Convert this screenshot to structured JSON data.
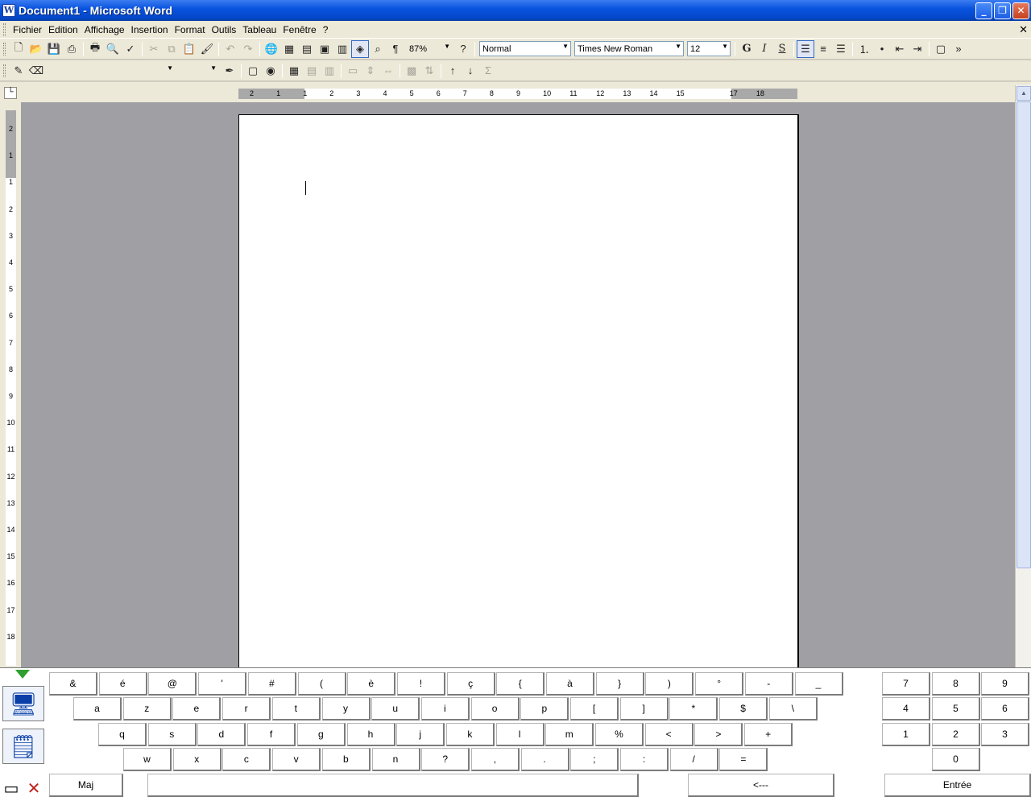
{
  "window": {
    "title": "Document1 - Microsoft Word",
    "app_icon": "W"
  },
  "menu": [
    "Fichier",
    "Edition",
    "Affichage",
    "Insertion",
    "Format",
    "Outils",
    "Tableau",
    "Fenêtre",
    "?"
  ],
  "toolbar": {
    "zoom": "87%",
    "style": "Normal",
    "font": "Times New Roman",
    "size": "12",
    "bold": "G",
    "italic": "I",
    "underline": "S"
  },
  "ruler_h": [
    "2",
    "1",
    "1",
    "2",
    "3",
    "4",
    "5",
    "6",
    "7",
    "8",
    "9",
    "10",
    "11",
    "12",
    "13",
    "14",
    "15",
    "17",
    "18"
  ],
  "ruler_v": [
    "2",
    "1",
    "1",
    "2",
    "3",
    "4",
    "5",
    "6",
    "7",
    "8",
    "9",
    "10",
    "11",
    "12",
    "13",
    "14",
    "15",
    "16",
    "17",
    "18"
  ],
  "keyboard": {
    "row1": [
      "&",
      "é",
      "@",
      "'",
      "#",
      "(",
      "è",
      "!",
      "ç",
      "{",
      "à",
      "}",
      ")",
      "°",
      "-",
      "_"
    ],
    "row2": [
      "a",
      "z",
      "e",
      "r",
      "t",
      "y",
      "u",
      "i",
      "o",
      "p",
      "[",
      "]",
      "*",
      "$",
      "\\"
    ],
    "row3": [
      "q",
      "s",
      "d",
      "f",
      "g",
      "h",
      "j",
      "k",
      "l",
      "m",
      "%",
      "<",
      ">",
      "+"
    ],
    "row4": [
      "w",
      "x",
      "c",
      "v",
      "b",
      "n",
      "?",
      ",",
      ".",
      ";",
      ":",
      "/",
      "="
    ],
    "num": [
      "7",
      "8",
      "9",
      "4",
      "5",
      "6",
      "1",
      "2",
      "3",
      "0"
    ],
    "shift": "Maj",
    "backspace": "<---",
    "enter": "Entrée"
  }
}
